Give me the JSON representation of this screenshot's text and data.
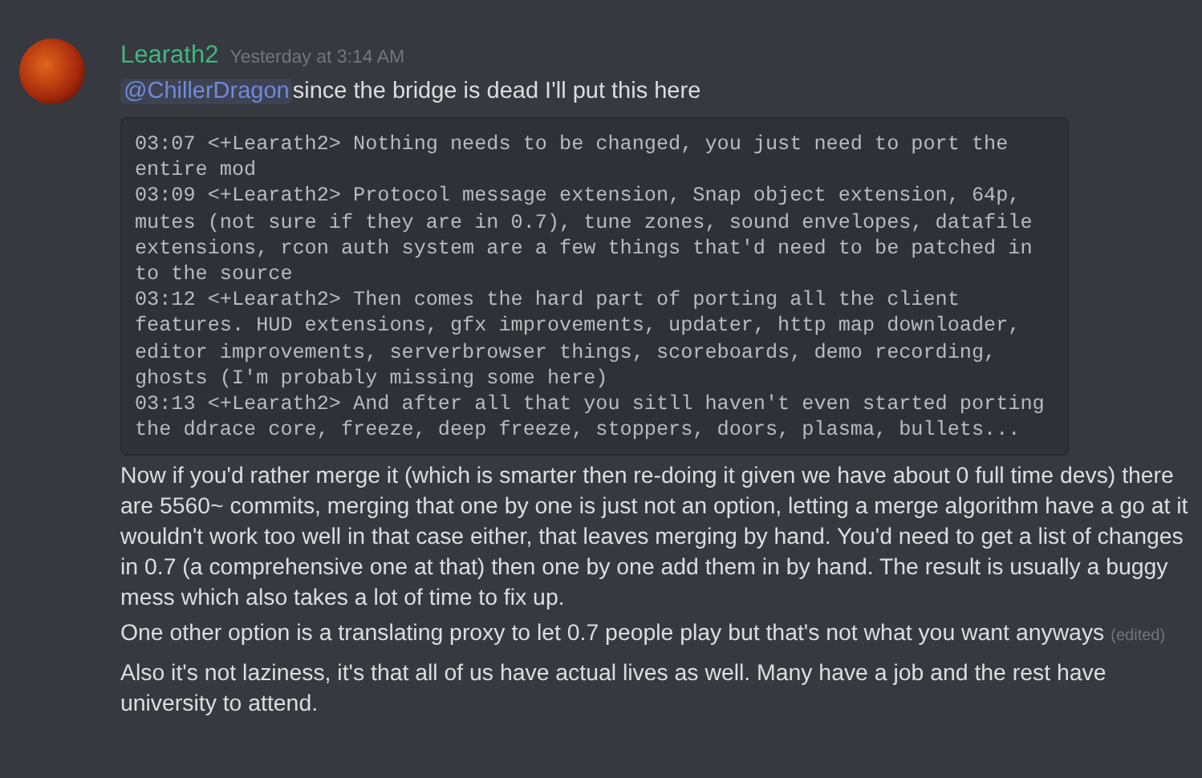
{
  "message": {
    "author": "Learath2",
    "timestamp": "Yesterday at 3:14 AM",
    "first_line": {
      "mention": "@ChillerDragon",
      "text": "since the bridge is dead I'll put this here"
    },
    "code_block": [
      "03:07 <+Learath2> Nothing needs to be changed, you just need to port the entire mod",
      "03:09 <+Learath2> Protocol message extension, Snap object extension, 64p, mutes (not sure if they are in 0.7), tune zones, sound envelopes, datafile extensions, rcon auth system are a few things that'd need to be patched in to the source",
      "03:12 <+Learath2> Then comes the hard part of porting all the client features. HUD extensions, gfx improvements, updater, http map downloader, editor improvements, serverbrowser things, scoreboards, demo recording, ghosts (I'm probably missing some here)",
      "03:13 <+Learath2> And after all that you sitll haven't even started porting the ddrace core, freeze, deep freeze, stoppers, doors, plasma, bullets..."
    ],
    "paragraphs": [
      {
        "text": "Now if you'd rather merge it (which is smarter then re-doing it given we have about 0 full time devs) there are 5560~ commits, merging that one by one is just not an option, letting a merge algorithm have a go at it wouldn't work too well in that case either, that leaves merging by hand. You'd need to get a list of changes in 0.7 (a comprehensive one at that) then one by one add them in by hand. The result is usually a buggy mess which also takes a lot of time to fix up.",
        "edited": false
      },
      {
        "text": "One other option is a translating proxy to let 0.7 people play but that's not what you want anyways",
        "edited": true,
        "edited_label": "(edited)"
      },
      {
        "text": "Also it's not laziness, it's that all of us have actual lives as well. Many have a job and the rest have university to attend.",
        "edited": false
      }
    ]
  }
}
